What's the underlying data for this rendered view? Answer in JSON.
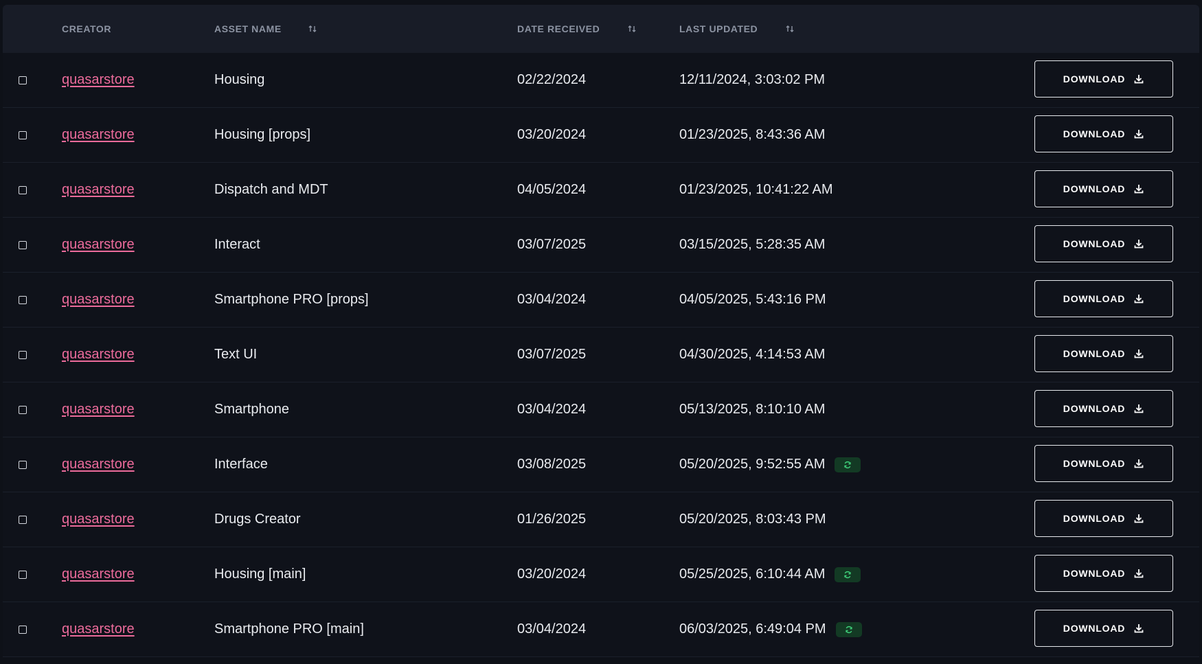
{
  "columns": {
    "creator": "CREATOR",
    "asset_name": "ASSET NAME",
    "date_received": "DATE RECEIVED",
    "last_updated": "LAST UPDATED"
  },
  "download_label": "DOWNLOAD",
  "rows": [
    {
      "creator": "quasarstore",
      "asset": "Housing",
      "received": "02/22/2024",
      "updated": "12/11/2024, 3:03:02 PM",
      "synced": false
    },
    {
      "creator": "quasarstore",
      "asset": "Housing [props]",
      "received": "03/20/2024",
      "updated": "01/23/2025, 8:43:36 AM",
      "synced": false
    },
    {
      "creator": "quasarstore",
      "asset": "Dispatch and MDT",
      "received": "04/05/2024",
      "updated": "01/23/2025, 10:41:22 AM",
      "synced": false
    },
    {
      "creator": "quasarstore",
      "asset": "Interact",
      "received": "03/07/2025",
      "updated": "03/15/2025, 5:28:35 AM",
      "synced": false
    },
    {
      "creator": "quasarstore",
      "asset": "Smartphone PRO [props]",
      "received": "03/04/2024",
      "updated": "04/05/2025, 5:43:16 PM",
      "synced": false
    },
    {
      "creator": "quasarstore",
      "asset": "Text UI",
      "received": "03/07/2025",
      "updated": "04/30/2025, 4:14:53 AM",
      "synced": false
    },
    {
      "creator": "quasarstore",
      "asset": "Smartphone",
      "received": "03/04/2024",
      "updated": "05/13/2025, 8:10:10 AM",
      "synced": false
    },
    {
      "creator": "quasarstore",
      "asset": "Interface",
      "received": "03/08/2025",
      "updated": "05/20/2025, 9:52:55 AM",
      "synced": true
    },
    {
      "creator": "quasarstore",
      "asset": "Drugs Creator",
      "received": "01/26/2025",
      "updated": "05/20/2025, 8:03:43 PM",
      "synced": false
    },
    {
      "creator": "quasarstore",
      "asset": "Housing [main]",
      "received": "03/20/2024",
      "updated": "05/25/2025, 6:10:44 AM",
      "synced": true
    },
    {
      "creator": "quasarstore",
      "asset": "Smartphone PRO [main]",
      "received": "03/04/2024",
      "updated": "06/03/2025, 6:49:04 PM",
      "synced": true
    }
  ],
  "colors": {
    "background": "#0e1118",
    "header_bg": "#181c27",
    "creator_link": "#ec6b9b",
    "sync_badge_bg": "#133a24",
    "sync_icon": "#3fd07a"
  },
  "icons": {
    "sort": "sort-arrows-icon",
    "download": "download-icon",
    "sync": "sync-icon"
  }
}
